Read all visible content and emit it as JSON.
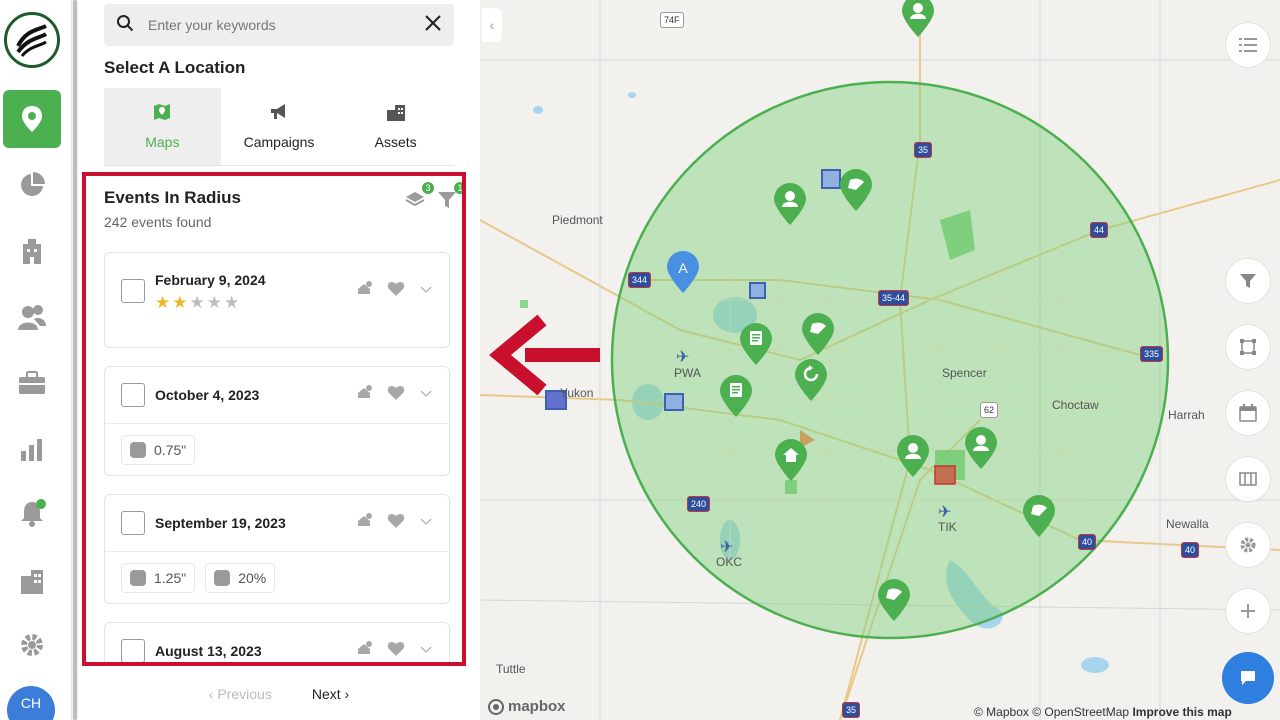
{
  "rail": {
    "items": [
      {
        "name": "map-pin-icon",
        "active": true
      },
      {
        "name": "pie-chart-icon"
      },
      {
        "name": "building-icon"
      },
      {
        "name": "users-icon"
      },
      {
        "name": "briefcase-icon"
      },
      {
        "name": "bar-chart-icon"
      },
      {
        "name": "bell-icon"
      },
      {
        "name": "office-icon"
      },
      {
        "name": "gear-icon"
      }
    ],
    "avatar_initials": "CH"
  },
  "search": {
    "placeholder": "Enter your keywords"
  },
  "panel": {
    "title": "Select A Location"
  },
  "tabs": [
    {
      "label": "Maps",
      "icon": "map-icon",
      "active": true
    },
    {
      "label": "Campaigns",
      "icon": "megaphone-icon"
    },
    {
      "label": "Assets",
      "icon": "assets-icon"
    }
  ],
  "events": {
    "title": "Events In Radius",
    "count_text": "242 events found",
    "layers_badge": "3",
    "filter_badge": "1",
    "cards": [
      {
        "date": "February 9, 2024",
        "rating": 2,
        "max_rating": 5
      },
      {
        "date": "October 4, 2023",
        "chips": [
          {
            "icon": "hail-icon",
            "text": "0.75\""
          }
        ]
      },
      {
        "date": "September 19, 2023",
        "chips": [
          {
            "icon": "hail-icon",
            "text": "1.25\""
          },
          {
            "icon": "shield-icon",
            "text": "20%"
          }
        ]
      },
      {
        "date": "August 13, 2023"
      }
    ]
  },
  "pager": {
    "prev": "Previous",
    "next": "Next"
  },
  "map": {
    "labels": [
      {
        "text": "Piedmont"
      },
      {
        "text": "PWA"
      },
      {
        "text": "Yukon"
      },
      {
        "text": "Spencer"
      },
      {
        "text": "Choctaw"
      },
      {
        "text": "Harrah"
      },
      {
        "text": "TIK"
      },
      {
        "text": "OKC"
      },
      {
        "text": "Newalla"
      },
      {
        "text": "Tuttle"
      }
    ],
    "shields": [
      "74F",
      "35",
      "44",
      "35-44",
      "344",
      "335",
      "62",
      "240",
      "40",
      "40",
      "35"
    ],
    "attribution_left": "© Mapbox © OpenStreetMap",
    "attribution_right": "Improve this map",
    "mapbox_logo": "mapbox"
  },
  "colors": {
    "accent": "#4caf50",
    "highlight_border": "#c8102e",
    "arrow": "#c8102e",
    "radius_fill": "#7ed07a",
    "chat": "#2f7fe0"
  }
}
